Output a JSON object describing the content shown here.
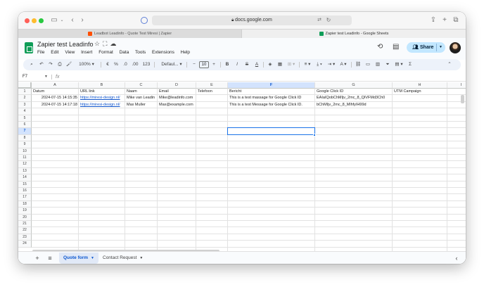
{
  "browser": {
    "url": "docs.google.com",
    "tabs": [
      {
        "label": "Leadbot Leadinfo - Quote Test Miresi | Zapier",
        "favicon_color": "#ff4f00"
      },
      {
        "label": "Zapier test Leadinfo - Google Sheets",
        "favicon_color": "#0f9d58"
      }
    ]
  },
  "sheets": {
    "title": "Zapier test Leadinfo",
    "menu": [
      "File",
      "Edit",
      "View",
      "Insert",
      "Format",
      "Data",
      "Tools",
      "Extensions",
      "Help"
    ],
    "share_label": "Share",
    "toolbar": {
      "zoom": "100%",
      "currency": "€",
      "percent": "%",
      "dec_less": ".0",
      "dec_more": ".00",
      "number_format": "123",
      "font": "Defaul...",
      "font_size": "10",
      "minus": "−",
      "plus": "+"
    },
    "name_box": "F7",
    "fx": "fx"
  },
  "grid": {
    "columns": [
      "A",
      "B",
      "C",
      "D",
      "E",
      "F",
      "G",
      "H",
      "I"
    ],
    "selected_column": "F",
    "selected_row": 7,
    "rows": [
      1,
      2,
      3,
      4,
      5,
      6,
      7,
      8,
      9,
      10,
      11,
      12,
      13,
      14,
      15,
      16,
      17,
      18,
      19,
      20,
      21,
      22,
      23,
      24
    ],
    "headers": [
      "Datum",
      "URL link",
      "Naam",
      "Email",
      "Telefoon",
      "Bericht",
      "Google Click ID",
      "UTM Campaign"
    ],
    "data_rows": [
      [
        "2024-07-15 14:15:35",
        "https://miresi-design.nl/",
        "Mike van Leadin",
        "Mike@leadinfo.com",
        "",
        "This is a test massage for Google Click ID",
        "EAIaIQobChMIjv_2mc_8_QIVFMd3Ch0",
        ""
      ],
      [
        "2024-07-15 14:17:18",
        "https://miresi-design.nl/",
        "Max Muller",
        "Max@example.com",
        "",
        "This is a test Message for Google Click ID.",
        "bChMIjv_2mc_8_MlhfyIH99d",
        ""
      ]
    ]
  },
  "sheet_tabs": [
    {
      "label": "Quote form",
      "active": true
    },
    {
      "label": "Contact Request",
      "active": false
    }
  ]
}
